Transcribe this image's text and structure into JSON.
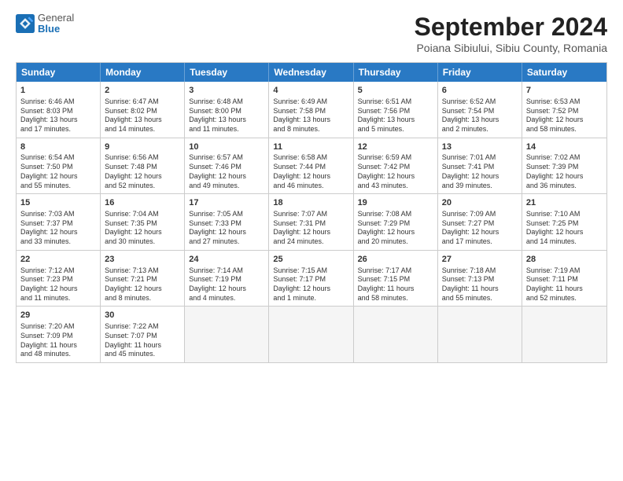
{
  "logo": {
    "line1": "General",
    "line2": "Blue"
  },
  "title": "September 2024",
  "subtitle": "Poiana Sibiului, Sibiu County, Romania",
  "days_of_week": [
    "Sunday",
    "Monday",
    "Tuesday",
    "Wednesday",
    "Thursday",
    "Friday",
    "Saturday"
  ],
  "weeks": [
    [
      {
        "day": "1",
        "info": "Sunrise: 6:46 AM\nSunset: 8:03 PM\nDaylight: 13 hours\nand 17 minutes."
      },
      {
        "day": "2",
        "info": "Sunrise: 6:47 AM\nSunset: 8:02 PM\nDaylight: 13 hours\nand 14 minutes."
      },
      {
        "day": "3",
        "info": "Sunrise: 6:48 AM\nSunset: 8:00 PM\nDaylight: 13 hours\nand 11 minutes."
      },
      {
        "day": "4",
        "info": "Sunrise: 6:49 AM\nSunset: 7:58 PM\nDaylight: 13 hours\nand 8 minutes."
      },
      {
        "day": "5",
        "info": "Sunrise: 6:51 AM\nSunset: 7:56 PM\nDaylight: 13 hours\nand 5 minutes."
      },
      {
        "day": "6",
        "info": "Sunrise: 6:52 AM\nSunset: 7:54 PM\nDaylight: 13 hours\nand 2 minutes."
      },
      {
        "day": "7",
        "info": "Sunrise: 6:53 AM\nSunset: 7:52 PM\nDaylight: 12 hours\nand 58 minutes."
      }
    ],
    [
      {
        "day": "8",
        "info": "Sunrise: 6:54 AM\nSunset: 7:50 PM\nDaylight: 12 hours\nand 55 minutes."
      },
      {
        "day": "9",
        "info": "Sunrise: 6:56 AM\nSunset: 7:48 PM\nDaylight: 12 hours\nand 52 minutes."
      },
      {
        "day": "10",
        "info": "Sunrise: 6:57 AM\nSunset: 7:46 PM\nDaylight: 12 hours\nand 49 minutes."
      },
      {
        "day": "11",
        "info": "Sunrise: 6:58 AM\nSunset: 7:44 PM\nDaylight: 12 hours\nand 46 minutes."
      },
      {
        "day": "12",
        "info": "Sunrise: 6:59 AM\nSunset: 7:42 PM\nDaylight: 12 hours\nand 43 minutes."
      },
      {
        "day": "13",
        "info": "Sunrise: 7:01 AM\nSunset: 7:41 PM\nDaylight: 12 hours\nand 39 minutes."
      },
      {
        "day": "14",
        "info": "Sunrise: 7:02 AM\nSunset: 7:39 PM\nDaylight: 12 hours\nand 36 minutes."
      }
    ],
    [
      {
        "day": "15",
        "info": "Sunrise: 7:03 AM\nSunset: 7:37 PM\nDaylight: 12 hours\nand 33 minutes."
      },
      {
        "day": "16",
        "info": "Sunrise: 7:04 AM\nSunset: 7:35 PM\nDaylight: 12 hours\nand 30 minutes."
      },
      {
        "day": "17",
        "info": "Sunrise: 7:05 AM\nSunset: 7:33 PM\nDaylight: 12 hours\nand 27 minutes."
      },
      {
        "day": "18",
        "info": "Sunrise: 7:07 AM\nSunset: 7:31 PM\nDaylight: 12 hours\nand 24 minutes."
      },
      {
        "day": "19",
        "info": "Sunrise: 7:08 AM\nSunset: 7:29 PM\nDaylight: 12 hours\nand 20 minutes."
      },
      {
        "day": "20",
        "info": "Sunrise: 7:09 AM\nSunset: 7:27 PM\nDaylight: 12 hours\nand 17 minutes."
      },
      {
        "day": "21",
        "info": "Sunrise: 7:10 AM\nSunset: 7:25 PM\nDaylight: 12 hours\nand 14 minutes."
      }
    ],
    [
      {
        "day": "22",
        "info": "Sunrise: 7:12 AM\nSunset: 7:23 PM\nDaylight: 12 hours\nand 11 minutes."
      },
      {
        "day": "23",
        "info": "Sunrise: 7:13 AM\nSunset: 7:21 PM\nDaylight: 12 hours\nand 8 minutes."
      },
      {
        "day": "24",
        "info": "Sunrise: 7:14 AM\nSunset: 7:19 PM\nDaylight: 12 hours\nand 4 minutes."
      },
      {
        "day": "25",
        "info": "Sunrise: 7:15 AM\nSunset: 7:17 PM\nDaylight: 12 hours\nand 1 minute."
      },
      {
        "day": "26",
        "info": "Sunrise: 7:17 AM\nSunset: 7:15 PM\nDaylight: 11 hours\nand 58 minutes."
      },
      {
        "day": "27",
        "info": "Sunrise: 7:18 AM\nSunset: 7:13 PM\nDaylight: 11 hours\nand 55 minutes."
      },
      {
        "day": "28",
        "info": "Sunrise: 7:19 AM\nSunset: 7:11 PM\nDaylight: 11 hours\nand 52 minutes."
      }
    ],
    [
      {
        "day": "29",
        "info": "Sunrise: 7:20 AM\nSunset: 7:09 PM\nDaylight: 11 hours\nand 48 minutes."
      },
      {
        "day": "30",
        "info": "Sunrise: 7:22 AM\nSunset: 7:07 PM\nDaylight: 11 hours\nand 45 minutes."
      },
      {
        "day": "",
        "info": ""
      },
      {
        "day": "",
        "info": ""
      },
      {
        "day": "",
        "info": ""
      },
      {
        "day": "",
        "info": ""
      },
      {
        "day": "",
        "info": ""
      }
    ]
  ]
}
